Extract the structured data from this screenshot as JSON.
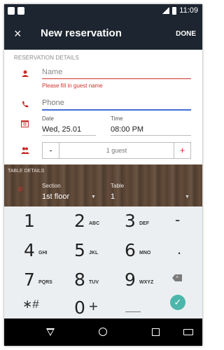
{
  "status_bar": {
    "time": "11:09"
  },
  "app_bar": {
    "close_icon": "×",
    "title": "New reservation",
    "done_label": "DONE"
  },
  "reservation": {
    "section_label": "RESERVATION DETAILS",
    "name_placeholder": "Name",
    "name_error": "Please fill in guest name",
    "phone_placeholder": "Phone",
    "date_label": "Date",
    "date_value": "Wed, 25.01",
    "time_label": "Time",
    "time_value": "08:00 PM",
    "guest_minus": "-",
    "guest_count": "1 guest",
    "guest_plus": "+"
  },
  "table_details": {
    "section_label": "TABLE DETAILS",
    "section_field_label": "Section",
    "section_value": "1st floor",
    "table_field_label": "Table",
    "table_value": "1"
  },
  "keypad": {
    "keys": [
      {
        "num": "1",
        "letters": ""
      },
      {
        "num": "2",
        "letters": "ABC"
      },
      {
        "num": "3",
        "letters": "DEF"
      },
      {
        "num": "4",
        "letters": "GHI"
      },
      {
        "num": "5",
        "letters": "JKL"
      },
      {
        "num": "6",
        "letters": "MNO"
      },
      {
        "num": "7",
        "letters": "PQRS"
      },
      {
        "num": "8",
        "letters": "TUV"
      },
      {
        "num": "9",
        "letters": "WXYZ"
      },
      {
        "num": "0",
        "letters": ""
      }
    ],
    "minus": "-",
    "dot": ".",
    "star_hash": "∗#",
    "plus": "+",
    "ok_icon": "✓",
    "backspace_icon": "×"
  },
  "colors": {
    "accent_red": "#d0312d",
    "appbar": "#1c2530",
    "ok_teal": "#4db6ac",
    "phone_focus": "#3f6fd8"
  },
  "icons": [
    "person-icon",
    "phone-icon",
    "calendar-icon",
    "group-icon",
    "hash-icon",
    "backspace-icon",
    "check-icon",
    "back-nav-icon",
    "home-nav-icon",
    "recents-nav-icon",
    "keyboard-nav-icon"
  ]
}
